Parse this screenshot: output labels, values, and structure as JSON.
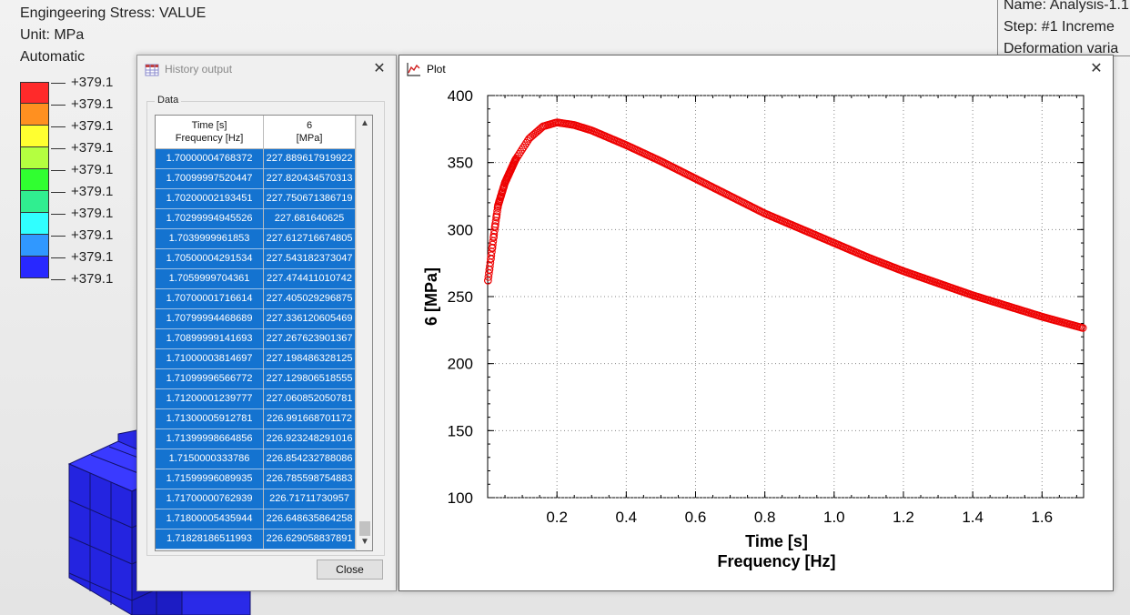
{
  "viewport": {
    "legend_title": "Engingeering Stress: VALUE",
    "unit": "Unit: MPa",
    "mode": "Automatic",
    "legend_colors": [
      "#ff2a2a",
      "#ff9020",
      "#ffff30",
      "#b4ff40",
      "#30ff30",
      "#30ee90",
      "#30ffff",
      "#3098ff",
      "#2828ff"
    ],
    "legend_values": [
      "+379.1",
      "+379.1",
      "+379.1",
      "+379.1",
      "+379.1",
      "+379.1",
      "+379.1",
      "+379.1",
      "+379.1",
      "+379.1"
    ],
    "info": [
      "Name: Analysis-1.1",
      "Step: #1   Increme",
      "Deformation varia"
    ]
  },
  "history": {
    "title": "History output",
    "group_label": "Data",
    "col1_header_line1": "Time [s]",
    "col1_header_line2": "Frequency [Hz]",
    "col2_header_line1": "6",
    "col2_header_line2": "[MPa]",
    "close_label": "Close",
    "rows": [
      [
        "1.70000004768372",
        "227.889617919922"
      ],
      [
        "1.70099997520447",
        "227.820434570313"
      ],
      [
        "1.70200002193451",
        "227.750671386719"
      ],
      [
        "1.70299994945526",
        "227.681640625"
      ],
      [
        "1.7039999961853",
        "227.612716674805"
      ],
      [
        "1.70500004291534",
        "227.543182373047"
      ],
      [
        "1.7059999704361",
        "227.474411010742"
      ],
      [
        "1.70700001716614",
        "227.405029296875"
      ],
      [
        "1.70799994468689",
        "227.336120605469"
      ],
      [
        "1.70899999141693",
        "227.267623901367"
      ],
      [
        "1.71000003814697",
        "227.198486328125"
      ],
      [
        "1.71099996566772",
        "227.129806518555"
      ],
      [
        "1.71200001239777",
        "227.060852050781"
      ],
      [
        "1.71300005912781",
        "226.991668701172"
      ],
      [
        "1.71399998664856",
        "226.923248291016"
      ],
      [
        "1.7150000333786",
        "226.854232788086"
      ],
      [
        "1.71599996089935",
        "226.785598754883"
      ],
      [
        "1.71700000762939",
        "226.71711730957"
      ],
      [
        "1.71800005435944",
        "226.648635864258"
      ],
      [
        "1.71828186511993",
        "226.629058837891"
      ]
    ]
  },
  "plot": {
    "title": "Plot"
  },
  "chart_data": {
    "type": "scatter",
    "x": [
      0.001,
      0.01,
      0.02,
      0.03,
      0.05,
      0.08,
      0.12,
      0.16,
      0.2,
      0.25,
      0.3,
      0.4,
      0.5,
      0.6,
      0.7,
      0.8,
      0.9,
      1.0,
      1.1,
      1.2,
      1.3,
      1.4,
      1.5,
      1.6,
      1.718
    ],
    "y": [
      262,
      280,
      300,
      318,
      335,
      352,
      368,
      377,
      380,
      378,
      374,
      363,
      351,
      338,
      325,
      312,
      301,
      290,
      279,
      269,
      260,
      251,
      243,
      235,
      226.6
    ],
    "xlabel": "Time [s]",
    "xlabel2": "Frequency [Hz]",
    "ylabel": "6 [MPa]",
    "xlim": [
      0,
      1.72
    ],
    "ylim": [
      100,
      400
    ],
    "xticks": [
      0.2,
      0.4,
      0.6,
      0.8,
      1.0,
      1.2,
      1.4,
      1.6
    ],
    "xtick_labels": [
      "0.2",
      "0.4",
      "0.6",
      "0.8",
      "1.0",
      "1.2",
      "1.4",
      "1.6"
    ],
    "yticks": [
      100,
      150,
      200,
      250,
      300,
      350,
      400
    ],
    "ytick_labels": [
      "100",
      "150",
      "200",
      "250",
      "300",
      "350",
      "400"
    ],
    "marker": "open-circle",
    "color": "#ee0000"
  }
}
